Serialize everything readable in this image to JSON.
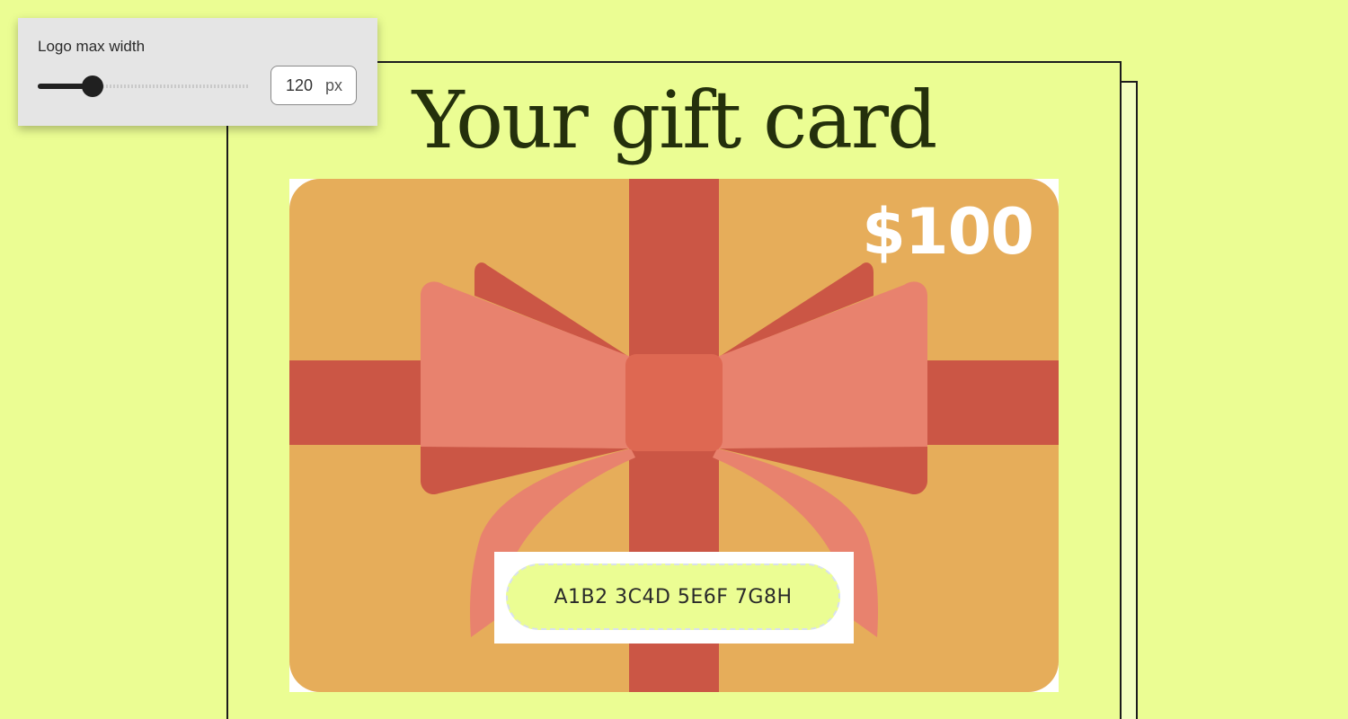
{
  "settings_panel": {
    "label": "Logo max width",
    "slider_fraction": 0.26,
    "value": "120",
    "unit": "px"
  },
  "page": {
    "heading": "Your gift card"
  },
  "gift_card": {
    "amount": "$100",
    "code": "A1B2 3C4D 5E6F 7G8H",
    "colors": {
      "card": "#e6ad5a",
      "ribbon": "#cb5645",
      "bow": "#e8826e",
      "knot": "#de6852",
      "page_bg": "#ebfd93"
    }
  }
}
